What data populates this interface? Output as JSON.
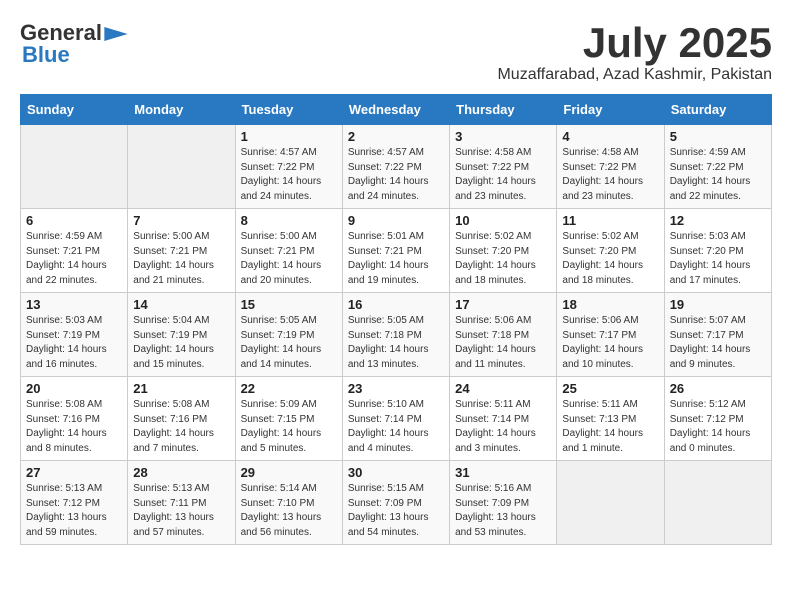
{
  "header": {
    "logo_general": "General",
    "logo_blue": "Blue",
    "month_year": "July 2025",
    "location": "Muzaffarabad, Azad Kashmir, Pakistan"
  },
  "weekdays": [
    "Sunday",
    "Monday",
    "Tuesday",
    "Wednesday",
    "Thursday",
    "Friday",
    "Saturday"
  ],
  "weeks": [
    [
      {
        "day": "",
        "content": ""
      },
      {
        "day": "",
        "content": ""
      },
      {
        "day": "1",
        "content": "Sunrise: 4:57 AM\nSunset: 7:22 PM\nDaylight: 14 hours\nand 24 minutes."
      },
      {
        "day": "2",
        "content": "Sunrise: 4:57 AM\nSunset: 7:22 PM\nDaylight: 14 hours\nand 24 minutes."
      },
      {
        "day": "3",
        "content": "Sunrise: 4:58 AM\nSunset: 7:22 PM\nDaylight: 14 hours\nand 23 minutes."
      },
      {
        "day": "4",
        "content": "Sunrise: 4:58 AM\nSunset: 7:22 PM\nDaylight: 14 hours\nand 23 minutes."
      },
      {
        "day": "5",
        "content": "Sunrise: 4:59 AM\nSunset: 7:22 PM\nDaylight: 14 hours\nand 22 minutes."
      }
    ],
    [
      {
        "day": "6",
        "content": "Sunrise: 4:59 AM\nSunset: 7:21 PM\nDaylight: 14 hours\nand 22 minutes."
      },
      {
        "day": "7",
        "content": "Sunrise: 5:00 AM\nSunset: 7:21 PM\nDaylight: 14 hours\nand 21 minutes."
      },
      {
        "day": "8",
        "content": "Sunrise: 5:00 AM\nSunset: 7:21 PM\nDaylight: 14 hours\nand 20 minutes."
      },
      {
        "day": "9",
        "content": "Sunrise: 5:01 AM\nSunset: 7:21 PM\nDaylight: 14 hours\nand 19 minutes."
      },
      {
        "day": "10",
        "content": "Sunrise: 5:02 AM\nSunset: 7:20 PM\nDaylight: 14 hours\nand 18 minutes."
      },
      {
        "day": "11",
        "content": "Sunrise: 5:02 AM\nSunset: 7:20 PM\nDaylight: 14 hours\nand 18 minutes."
      },
      {
        "day": "12",
        "content": "Sunrise: 5:03 AM\nSunset: 7:20 PM\nDaylight: 14 hours\nand 17 minutes."
      }
    ],
    [
      {
        "day": "13",
        "content": "Sunrise: 5:03 AM\nSunset: 7:19 PM\nDaylight: 14 hours\nand 16 minutes."
      },
      {
        "day": "14",
        "content": "Sunrise: 5:04 AM\nSunset: 7:19 PM\nDaylight: 14 hours\nand 15 minutes."
      },
      {
        "day": "15",
        "content": "Sunrise: 5:05 AM\nSunset: 7:19 PM\nDaylight: 14 hours\nand 14 minutes."
      },
      {
        "day": "16",
        "content": "Sunrise: 5:05 AM\nSunset: 7:18 PM\nDaylight: 14 hours\nand 13 minutes."
      },
      {
        "day": "17",
        "content": "Sunrise: 5:06 AM\nSunset: 7:18 PM\nDaylight: 14 hours\nand 11 minutes."
      },
      {
        "day": "18",
        "content": "Sunrise: 5:06 AM\nSunset: 7:17 PM\nDaylight: 14 hours\nand 10 minutes."
      },
      {
        "day": "19",
        "content": "Sunrise: 5:07 AM\nSunset: 7:17 PM\nDaylight: 14 hours\nand 9 minutes."
      }
    ],
    [
      {
        "day": "20",
        "content": "Sunrise: 5:08 AM\nSunset: 7:16 PM\nDaylight: 14 hours\nand 8 minutes."
      },
      {
        "day": "21",
        "content": "Sunrise: 5:08 AM\nSunset: 7:16 PM\nDaylight: 14 hours\nand 7 minutes."
      },
      {
        "day": "22",
        "content": "Sunrise: 5:09 AM\nSunset: 7:15 PM\nDaylight: 14 hours\nand 5 minutes."
      },
      {
        "day": "23",
        "content": "Sunrise: 5:10 AM\nSunset: 7:14 PM\nDaylight: 14 hours\nand 4 minutes."
      },
      {
        "day": "24",
        "content": "Sunrise: 5:11 AM\nSunset: 7:14 PM\nDaylight: 14 hours\nand 3 minutes."
      },
      {
        "day": "25",
        "content": "Sunrise: 5:11 AM\nSunset: 7:13 PM\nDaylight: 14 hours\nand 1 minute."
      },
      {
        "day": "26",
        "content": "Sunrise: 5:12 AM\nSunset: 7:12 PM\nDaylight: 14 hours\nand 0 minutes."
      }
    ],
    [
      {
        "day": "27",
        "content": "Sunrise: 5:13 AM\nSunset: 7:12 PM\nDaylight: 13 hours\nand 59 minutes."
      },
      {
        "day": "28",
        "content": "Sunrise: 5:13 AM\nSunset: 7:11 PM\nDaylight: 13 hours\nand 57 minutes."
      },
      {
        "day": "29",
        "content": "Sunrise: 5:14 AM\nSunset: 7:10 PM\nDaylight: 13 hours\nand 56 minutes."
      },
      {
        "day": "30",
        "content": "Sunrise: 5:15 AM\nSunset: 7:09 PM\nDaylight: 13 hours\nand 54 minutes."
      },
      {
        "day": "31",
        "content": "Sunrise: 5:16 AM\nSunset: 7:09 PM\nDaylight: 13 hours\nand 53 minutes."
      },
      {
        "day": "",
        "content": ""
      },
      {
        "day": "",
        "content": ""
      }
    ]
  ]
}
